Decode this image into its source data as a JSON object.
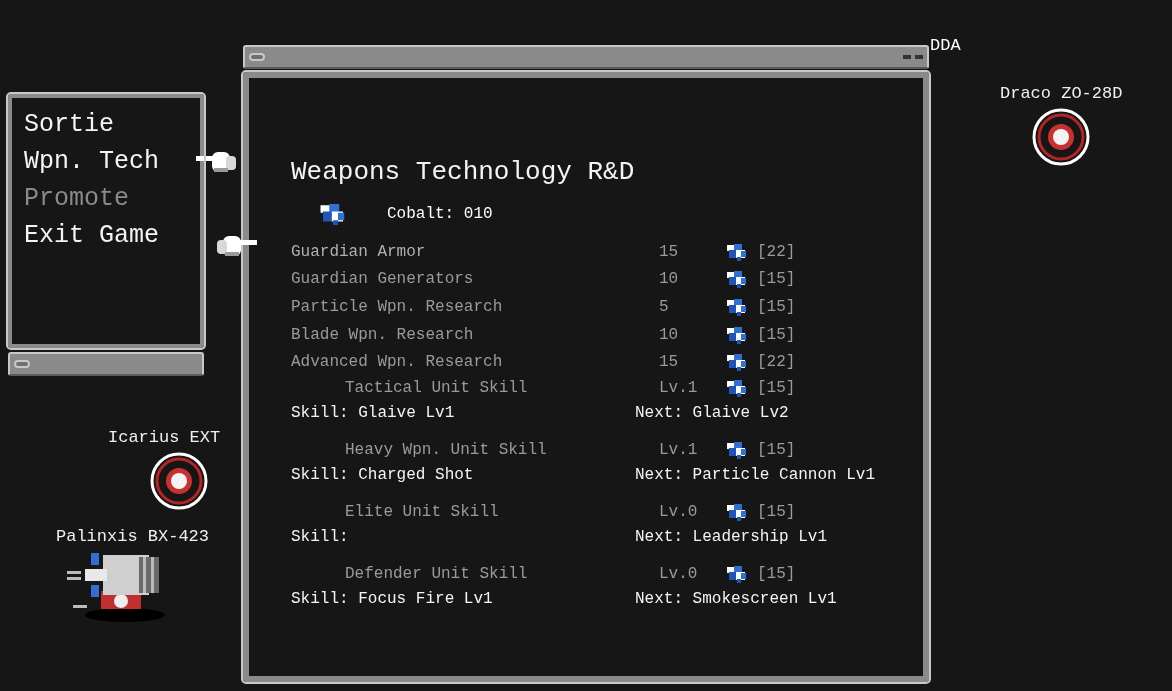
{
  "map_units": [
    {
      "name": "Draco ZO-28D",
      "kind": "target"
    },
    {
      "name": "Icarius EXT",
      "kind": "target"
    },
    {
      "name": "Palinxis BX-423",
      "kind": "ship"
    }
  ],
  "hidden_unit_label": "DDA",
  "menu": {
    "items": [
      {
        "label": "Sortie",
        "selected": false,
        "disabled": false
      },
      {
        "label": "Wpn. Tech",
        "selected": true,
        "disabled": false
      },
      {
        "label": "Promote",
        "selected": false,
        "disabled": true
      },
      {
        "label": "Exit Game",
        "selected": false,
        "disabled": false
      }
    ]
  },
  "window": {
    "title": "Weapons Technology R&D",
    "cobalt": "Cobalt: 010",
    "upgrades": [
      {
        "name": "Guardian Armor",
        "value": "15",
        "cost": "[22]",
        "selected": true
      },
      {
        "name": "Guardian Generators",
        "value": "10",
        "cost": "[15]",
        "selected": false
      },
      {
        "name": "Particle Wpn. Research",
        "value": "5",
        "cost": "[15]",
        "selected": false
      },
      {
        "name": "Blade Wpn. Research",
        "value": "10",
        "cost": "[15]",
        "selected": false
      },
      {
        "name": "Advanced Wpn. Research",
        "value": "15",
        "cost": "[22]",
        "selected": false
      }
    ],
    "skills": [
      {
        "name": "Tactical Unit Skill",
        "level": "Lv.1",
        "cost": "[15]",
        "skill": "Skill: Glaive Lv1",
        "next": "Next: Glaive Lv2"
      },
      {
        "name": "Heavy Wpn. Unit Skill",
        "level": "Lv.1",
        "cost": "[15]",
        "skill": "Skill: Charged Shot",
        "next": "Next: Particle Cannon Lv1"
      },
      {
        "name": "Elite Unit Skill",
        "level": "Lv.0",
        "cost": "[15]",
        "skill": "Skill:",
        "next": "Next: Leadership Lv1"
      },
      {
        "name": "Defender Unit Skill",
        "level": "Lv.0",
        "cost": "[15]",
        "skill": "Skill: Focus Fire Lv1",
        "next": "Next: Smokescreen Lv1"
      }
    ]
  }
}
